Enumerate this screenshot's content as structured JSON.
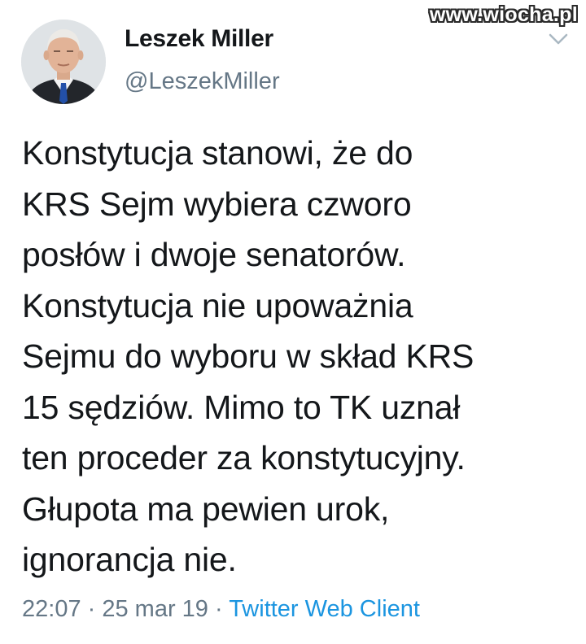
{
  "watermark": "www.wiocha.pl",
  "tweet": {
    "author": {
      "display_name": "Leszek Miller",
      "handle": "@LeszekMiller"
    },
    "text_lines": [
      "Konstytucja stanowi, że do",
      "KRS Sejm wybiera czworo",
      "posłów i dwoje senatorów.",
      "Konstytucja nie upoważnia",
      "Sejmu do wyboru w skład KRS",
      "15 sędziów. Mimo to TK uznał",
      "ten proceder za konstytucyjny.",
      "Głupota ma pewien urok,",
      "ignorancja nie."
    ],
    "time": "22:07",
    "separator": " · ",
    "date": "25 mar 19",
    "source": "Twitter Web Client"
  },
  "icons": {
    "menu": "chevron-down-icon",
    "avatar": "avatar"
  },
  "colors": {
    "text": "#14171a",
    "secondary": "#657786",
    "link": "#1b95e0"
  }
}
